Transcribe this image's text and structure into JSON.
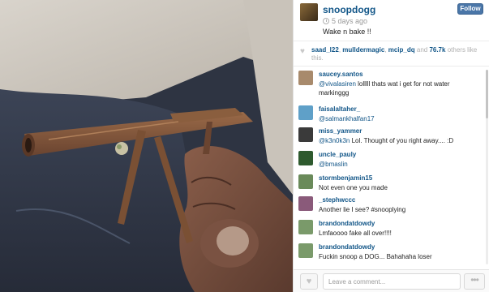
{
  "post": {
    "username": "snoopdogg",
    "time": "5 days ago",
    "caption": "Wake n bake !!",
    "follow_label": "Follow",
    "photo_alt": "Hand holding a rolled joint shaped like a rifle"
  },
  "likes": {
    "likers": [
      "saad_l22",
      "mulldermagic",
      "mcip_dq"
    ],
    "count_text": "76.7k",
    "suffix": "others like this."
  },
  "comments": [
    {
      "user": "saucey.santos",
      "mention": "@vivalasiren",
      "text": " lolllll thats wat i get for not water markinggg",
      "avatar_color": "#a88a6c"
    },
    {
      "user": "faisalaltaher_",
      "mention": "@salmankhalfan17",
      "text": "",
      "avatar_color": "#5fa0c8"
    },
    {
      "user": "miss_yammer",
      "mention": "@k3n0k3n",
      "text": " Lol. Thought of you right away.... :D",
      "avatar_color": "#3a3a3a"
    },
    {
      "user": "uncle_pauly",
      "mention": "@bmaslin",
      "text": "",
      "avatar_color": "#2e5a2e"
    },
    {
      "user": "stormbenjamin15",
      "mention": "",
      "text": "Not even one you made",
      "avatar_color": "#6a8a5a"
    },
    {
      "user": "_stephwccc",
      "mention": "",
      "text": "Another lie I see? #snooplying",
      "avatar_color": "#8a5a7a"
    },
    {
      "user": "brandondatdowdy",
      "mention": "",
      "text": "Lmfaoooo fake all over!!!!",
      "avatar_color": "#7a9a6a"
    },
    {
      "user": "brandondatdowdy",
      "mention": "",
      "text": "Fuckin snoop a DOG... Bahahaha loser",
      "avatar_color": "#7a9a6a"
    }
  ],
  "footer": {
    "comment_placeholder": "Leave a comment...",
    "like_icon": "heart-icon",
    "more_icon": "ellipsis-icon",
    "more_label": "•••",
    "like_label": "♥"
  },
  "colors": {
    "link": "#125688",
    "follow_bg": "#4a76a8",
    "muted": "#9a9a9a"
  }
}
